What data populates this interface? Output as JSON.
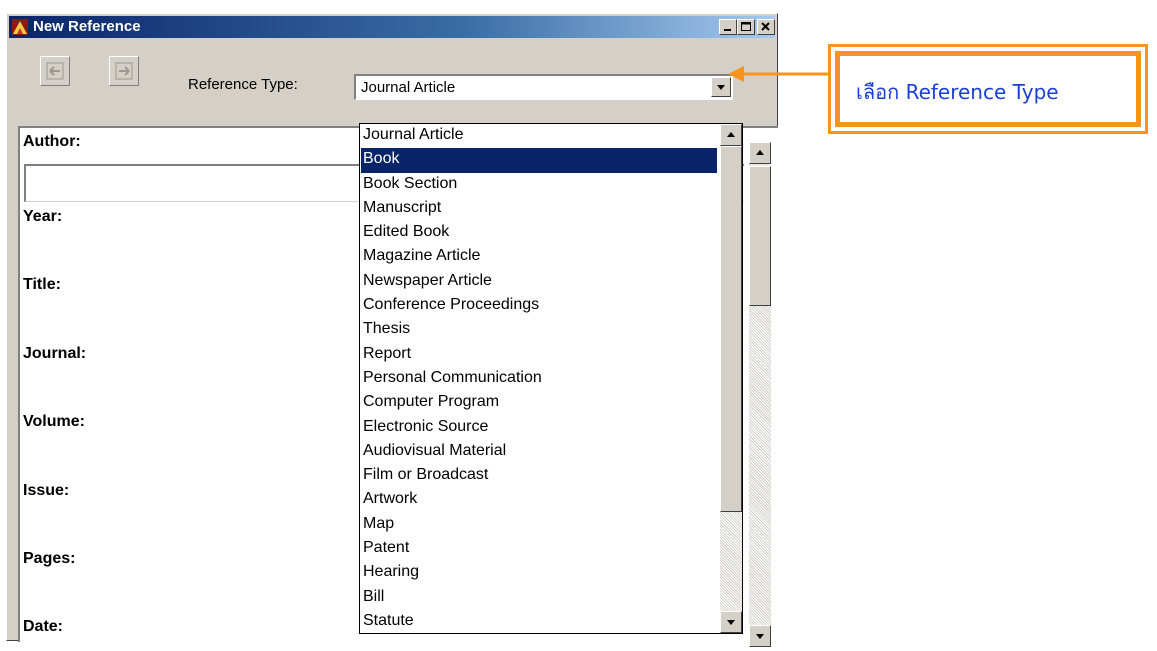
{
  "window": {
    "title": "New Reference",
    "caption_buttons": [
      "minimize",
      "maximize",
      "close"
    ]
  },
  "toolbar": {
    "buttons": [
      {
        "icon": "previous-reference-icon"
      },
      {
        "icon": "next-reference-icon"
      }
    ],
    "reference_type_label": "Reference Type:",
    "reference_type_value": "Journal Article"
  },
  "fields": [
    {
      "label": "Author:"
    },
    {
      "label": "Year:"
    },
    {
      "label": "Title:"
    },
    {
      "label": "Journal:"
    },
    {
      "label": "Volume:"
    },
    {
      "label": "Issue:"
    },
    {
      "label": "Pages:"
    },
    {
      "label": "Date:"
    }
  ],
  "dropdown": {
    "selected": "Book",
    "items": [
      "Journal Article",
      "Book",
      "Book Section",
      "Manuscript",
      "Edited Book",
      "Magazine Article",
      "Newspaper Article",
      "Conference Proceedings",
      "Thesis",
      "Report",
      "Personal Communication",
      "Computer Program",
      "Electronic Source",
      "Audiovisual Material",
      "Film or Broadcast",
      "Artwork",
      "Map",
      "Patent",
      "Hearing",
      "Bill",
      "Statute"
    ]
  },
  "callout": {
    "text": "เลือก Reference Type",
    "border_color": "#f7941d",
    "text_color": "#1a3fd6"
  },
  "colors": {
    "selection": "#0a246a",
    "title_bar": "#0a246a"
  }
}
